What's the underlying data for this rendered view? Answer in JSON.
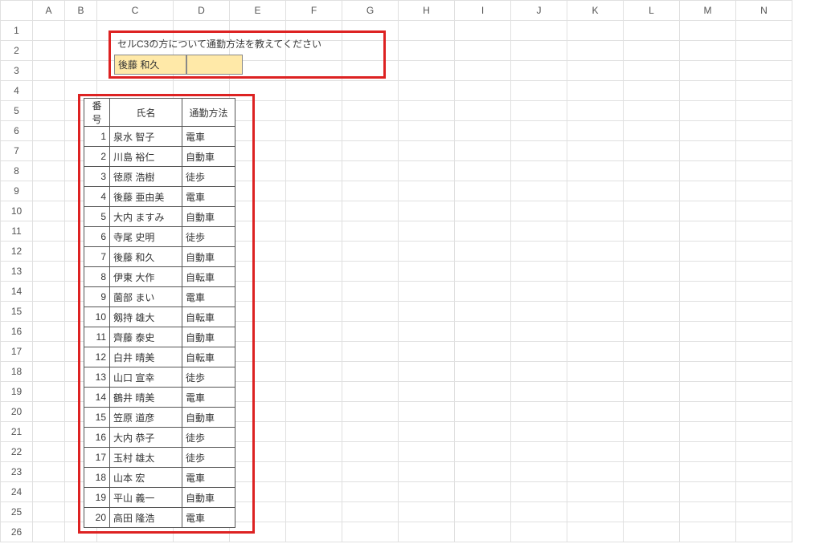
{
  "columns": [
    "A",
    "B",
    "C",
    "D",
    "E",
    "F",
    "G",
    "H",
    "I",
    "J",
    "K",
    "L",
    "M",
    "N"
  ],
  "row_count": 26,
  "top_box": {
    "instruction": "セルC3の方について通勤方法を教えてください",
    "name_value": "後藤 和久",
    "result_value": ""
  },
  "table_headers": {
    "num": "番号",
    "name": "氏名",
    "commute": "通勤方法"
  },
  "chart_data": {
    "type": "table",
    "title": "",
    "columns": [
      "番号",
      "氏名",
      "通勤方法"
    ],
    "rows": [
      {
        "num": 1,
        "name": "泉水 智子",
        "commute": "電車"
      },
      {
        "num": 2,
        "name": "川島 裕仁",
        "commute": "自動車"
      },
      {
        "num": 3,
        "name": "徳原 浩樹",
        "commute": "徒歩"
      },
      {
        "num": 4,
        "name": "後藤 亜由美",
        "commute": "電車"
      },
      {
        "num": 5,
        "name": "大内 ますみ",
        "commute": "自動車"
      },
      {
        "num": 6,
        "name": "寺尾 史明",
        "commute": "徒歩"
      },
      {
        "num": 7,
        "name": "後藤 和久",
        "commute": "自動車"
      },
      {
        "num": 8,
        "name": "伊東 大作",
        "commute": "自転車"
      },
      {
        "num": 9,
        "name": "薗部 まい",
        "commute": "電車"
      },
      {
        "num": 10,
        "name": "剱持 雄大",
        "commute": "自転車"
      },
      {
        "num": 11,
        "name": "齊藤 泰史",
        "commute": "自動車"
      },
      {
        "num": 12,
        "name": "白井 晴美",
        "commute": "自転車"
      },
      {
        "num": 13,
        "name": "山口 宣幸",
        "commute": "徒歩"
      },
      {
        "num": 14,
        "name": "鶴井 晴美",
        "commute": "電車"
      },
      {
        "num": 15,
        "name": "笠原 道彦",
        "commute": "自動車"
      },
      {
        "num": 16,
        "name": "大内 恭子",
        "commute": "徒歩"
      },
      {
        "num": 17,
        "name": "玉村 雄太",
        "commute": "徒歩"
      },
      {
        "num": 18,
        "name": "山本 宏",
        "commute": "電車"
      },
      {
        "num": 19,
        "name": "平山 義一",
        "commute": "自動車"
      },
      {
        "num": 20,
        "name": "高田 隆浩",
        "commute": "電車"
      }
    ]
  }
}
